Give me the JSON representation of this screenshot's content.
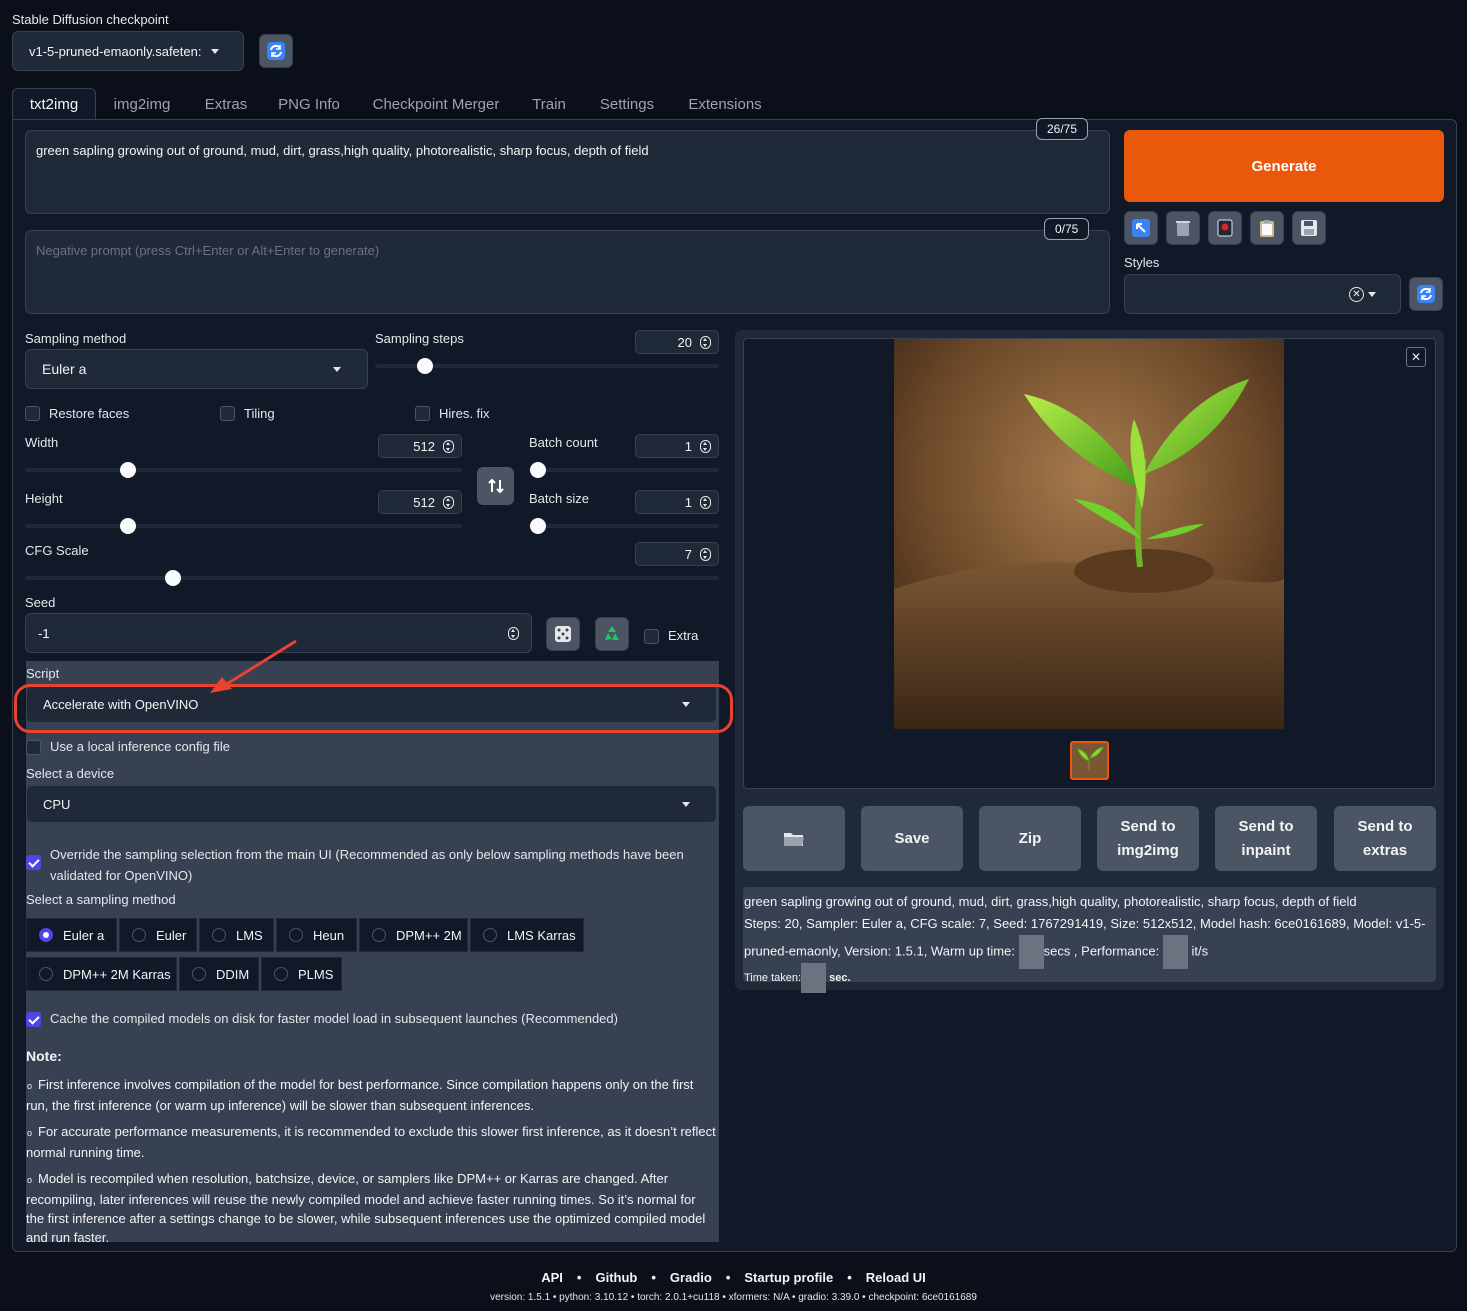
{
  "checkpoint": {
    "label": "Stable Diffusion checkpoint",
    "value": "v1-5-pruned-emaonly.safeten:"
  },
  "tabs": [
    "txt2img",
    "img2img",
    "Extras",
    "PNG Info",
    "Checkpoint Merger",
    "Train",
    "Settings",
    "Extensions"
  ],
  "prompt": {
    "value": "green sapling growing out of ground, mud, dirt, grass,high quality, photorealistic, sharp focus, depth  of field",
    "counter": "26/75"
  },
  "negative": {
    "placeholder": "Negative prompt (press Ctrl+Enter or Alt+Enter to generate)",
    "counter": "0/75"
  },
  "generate_label": "Generate",
  "styles_label": "Styles",
  "sampling": {
    "method_label": "Sampling method",
    "method_value": "Euler a",
    "steps_label": "Sampling steps",
    "steps_value": "20"
  },
  "checks": {
    "restore_faces": "Restore faces",
    "tiling": "Tiling",
    "hires": "Hires. fix"
  },
  "dims": {
    "width_label": "Width",
    "width_value": "512",
    "height_label": "Height",
    "height_value": "512",
    "batch_count_label": "Batch count",
    "batch_count_value": "1",
    "batch_size_label": "Batch size",
    "batch_size_value": "1",
    "cfg_label": "CFG Scale",
    "cfg_value": "7"
  },
  "seed": {
    "label": "Seed",
    "value": "-1",
    "extra_label": "Extra"
  },
  "script": {
    "label": "Script",
    "value": "Accelerate with OpenVINO"
  },
  "openvino": {
    "local_config_label": "Use a local inference config file",
    "device_label": "Select a device",
    "device_value": "CPU",
    "override_label": "Override the sampling selection from the main UI (Recommended as only below sampling methods have been validated for OpenVINO)",
    "sampler_label": "Select a sampling method",
    "samplers": [
      "Euler a",
      "Euler",
      "LMS",
      "Heun",
      "DPM++ 2M",
      "LMS Karras",
      "DPM++ 2M Karras",
      "DDIM",
      "PLMS"
    ],
    "selected_sampler": "Euler a",
    "cache_label": "Cache the compiled models on disk for faster model load in subsequent launches (Recommended)",
    "note_title": "Note:",
    "notes": [
      "First inference involves compilation of the model for best performance. Since compilation happens only on the first run, the first inference (or warm up inference) will be slower than subsequent inferences.",
      "For accurate performance measurements, it is recommended to exclude this slower first inference, as it doesn’t reflect normal running time.",
      "Model is recompiled when resolution, batchsize, device, or samplers like DPM++ or Karras are changed. After recompiling, later inferences will reuse the newly compiled model and achieve faster running times. So it’s normal for the first inference after a settings change to be slower, while subsequent inferences use the optimized compiled model and run faster."
    ]
  },
  "output_buttons": {
    "save": "Save",
    "zip": "Zip",
    "img2img_1": "Send to",
    "img2img_2": "img2img",
    "inpaint_1": "Send to",
    "inpaint_2": "inpaint",
    "extras_1": "Send to",
    "extras_2": "extras"
  },
  "info": {
    "line1": "green sapling growing out of ground, mud, dirt, grass,high quality, photorealistic, sharp focus, depth of field",
    "line2": "Steps: 20, Sampler: Euler a, CFG scale: 7, Seed: 1767291419, Size: 512x512, Model hash: 6ce0161689, Model: v1-5-",
    "line3a": "pruned-emaonly, Version: 1.5.1, Warm up time:",
    "line3b": "secs , Performance:",
    "line3c": "it/s",
    "time_label": "Time taken:",
    "time_unit": "sec."
  },
  "footer": {
    "links": [
      "API",
      "Github",
      "Gradio",
      "Startup profile",
      "Reload UI"
    ],
    "version": "version: 1.5.1  •  python: 3.10.12  •  torch: 2.0.1+cu118  •  xformers: N/A  •  gradio: 3.39.0  •  checkpoint: 6ce0161689"
  },
  "colors": {
    "accent": "#ea580c",
    "annotation": "#e8432f",
    "check": "#4f46e5"
  }
}
